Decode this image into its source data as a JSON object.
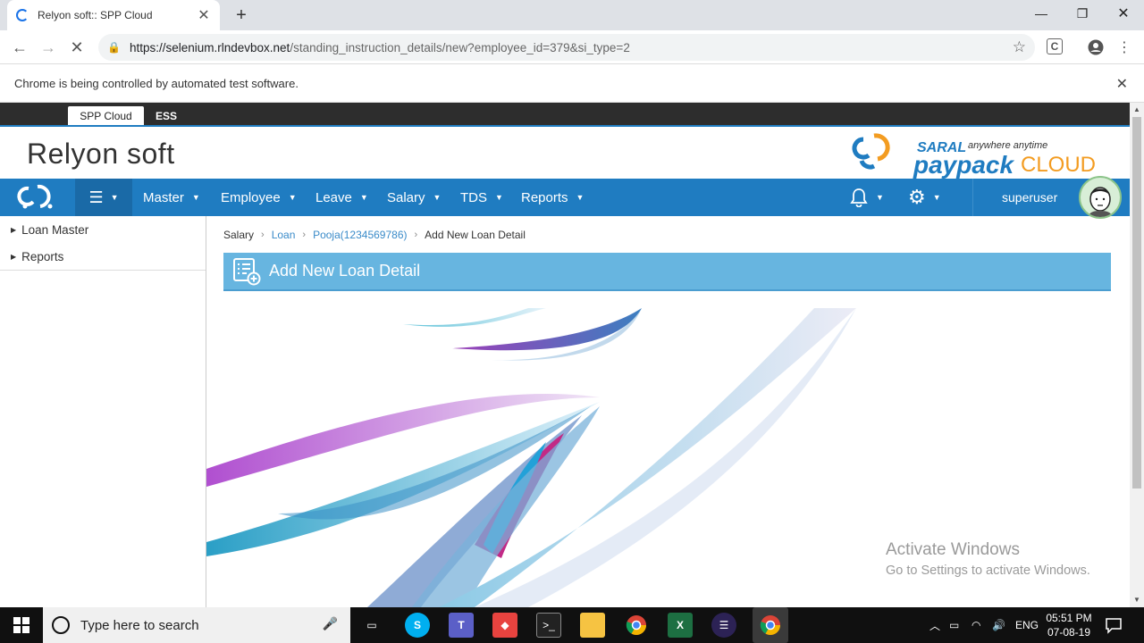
{
  "browser": {
    "tab_title": "Relyon soft:: SPP Cloud",
    "url_host": "https://selenium.rlndevbox.net",
    "url_path": "/standing_instruction_details/new?employee_id=379&si_type=2",
    "infobar_text": "Chrome is being controlled by automated test software."
  },
  "app": {
    "top_tabs": [
      "SPP Cloud",
      "ESS"
    ],
    "company": "Relyon soft",
    "logo": {
      "brand_top": "SARAL",
      "tagline": "anywhere anytime",
      "brand_a": "paypack",
      "brand_b": "CLOUD"
    },
    "menu": [
      "Master",
      "Employee",
      "Leave",
      "Salary",
      "TDS",
      "Reports"
    ],
    "username": "superuser",
    "colors": {
      "nav": "#1f7cc1",
      "panel": "#67b5e0",
      "link": "#3a8bc9",
      "brand_blue": "#1f7cc1",
      "brand_orange": "#f39c21"
    }
  },
  "sidebar": {
    "items": [
      "Loan Master",
      "Reports"
    ]
  },
  "breadcrumb": {
    "items": [
      "Salary",
      "Loan",
      "Pooja(1234569786)",
      "Add New Loan Detail"
    ]
  },
  "panel": {
    "title": "Add New Loan Detail",
    "icon": "list-add-icon"
  },
  "watermark": {
    "line1": "Activate Windows",
    "line2": "Go to Settings to activate Windows."
  },
  "taskbar": {
    "search_placeholder": "Type here to search",
    "lang": "ENG",
    "time": "05:51 PM",
    "date": "07-08-19"
  }
}
